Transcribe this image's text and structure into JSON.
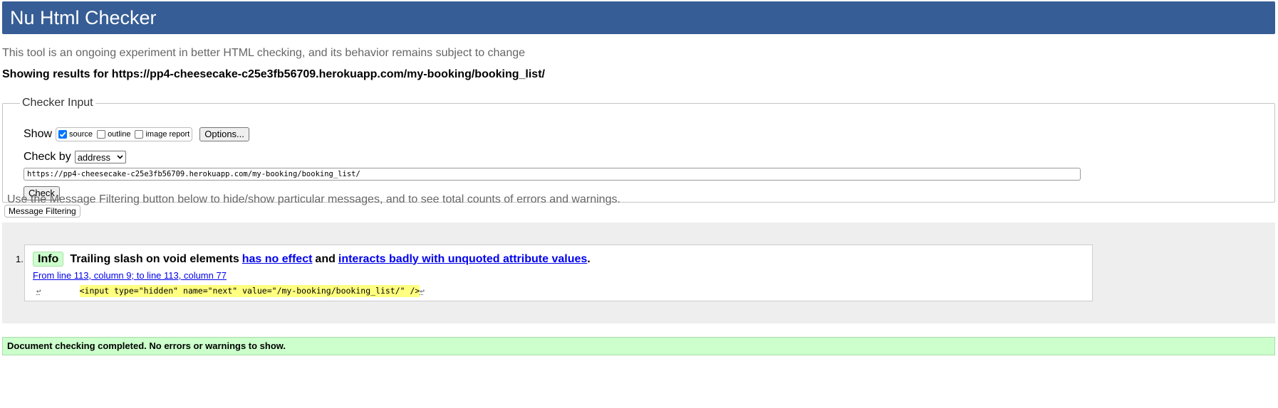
{
  "header": {
    "title": "Nu Html Checker"
  },
  "tagline": "This tool is an ongoing experiment in better HTML checking, and its behavior remains subject to change",
  "results_for": "Showing results for https://pp4-cheesecake-c25e3fb56709.herokuapp.com/my-booking/booking_list/",
  "checker_input": {
    "legend": "Checker Input",
    "show_label": "Show",
    "show_options": [
      {
        "label": "source",
        "checked": true
      },
      {
        "label": "outline",
        "checked": false
      },
      {
        "label": "image report",
        "checked": false
      }
    ],
    "options_button": "Options...",
    "check_by_label": "Check by",
    "check_by_value": "address",
    "url_value": "https://pp4-cheesecake-c25e3fb56709.herokuapp.com/my-booking/booking_list/",
    "check_button": "Check"
  },
  "filter_note": "Use the Message Filtering button below to hide/show particular messages, and to see total counts of errors and warnings.",
  "filter_button": "Message Filtering",
  "messages": [
    {
      "number": "1.",
      "type": "Info",
      "text_before": "Trailing slash on void elements",
      "link1": "has no effect",
      "text_mid": "and",
      "link2": "interacts badly with unquoted attribute values",
      "text_after": ".",
      "location": "From line 113, column 9; to line 113, column 77",
      "extract_code": "<input type=\"hidden\" name=\"next\" value=\"/my-booking/booking_list/\" />",
      "linefeed_symbol": "↩"
    }
  ],
  "completion": "Document checking completed. No errors or warnings to show.",
  "colors": {
    "header_bg": "#365d95",
    "info_bg": "#ccffcc",
    "highlight": "#ffff80",
    "link": "#0000ee"
  }
}
